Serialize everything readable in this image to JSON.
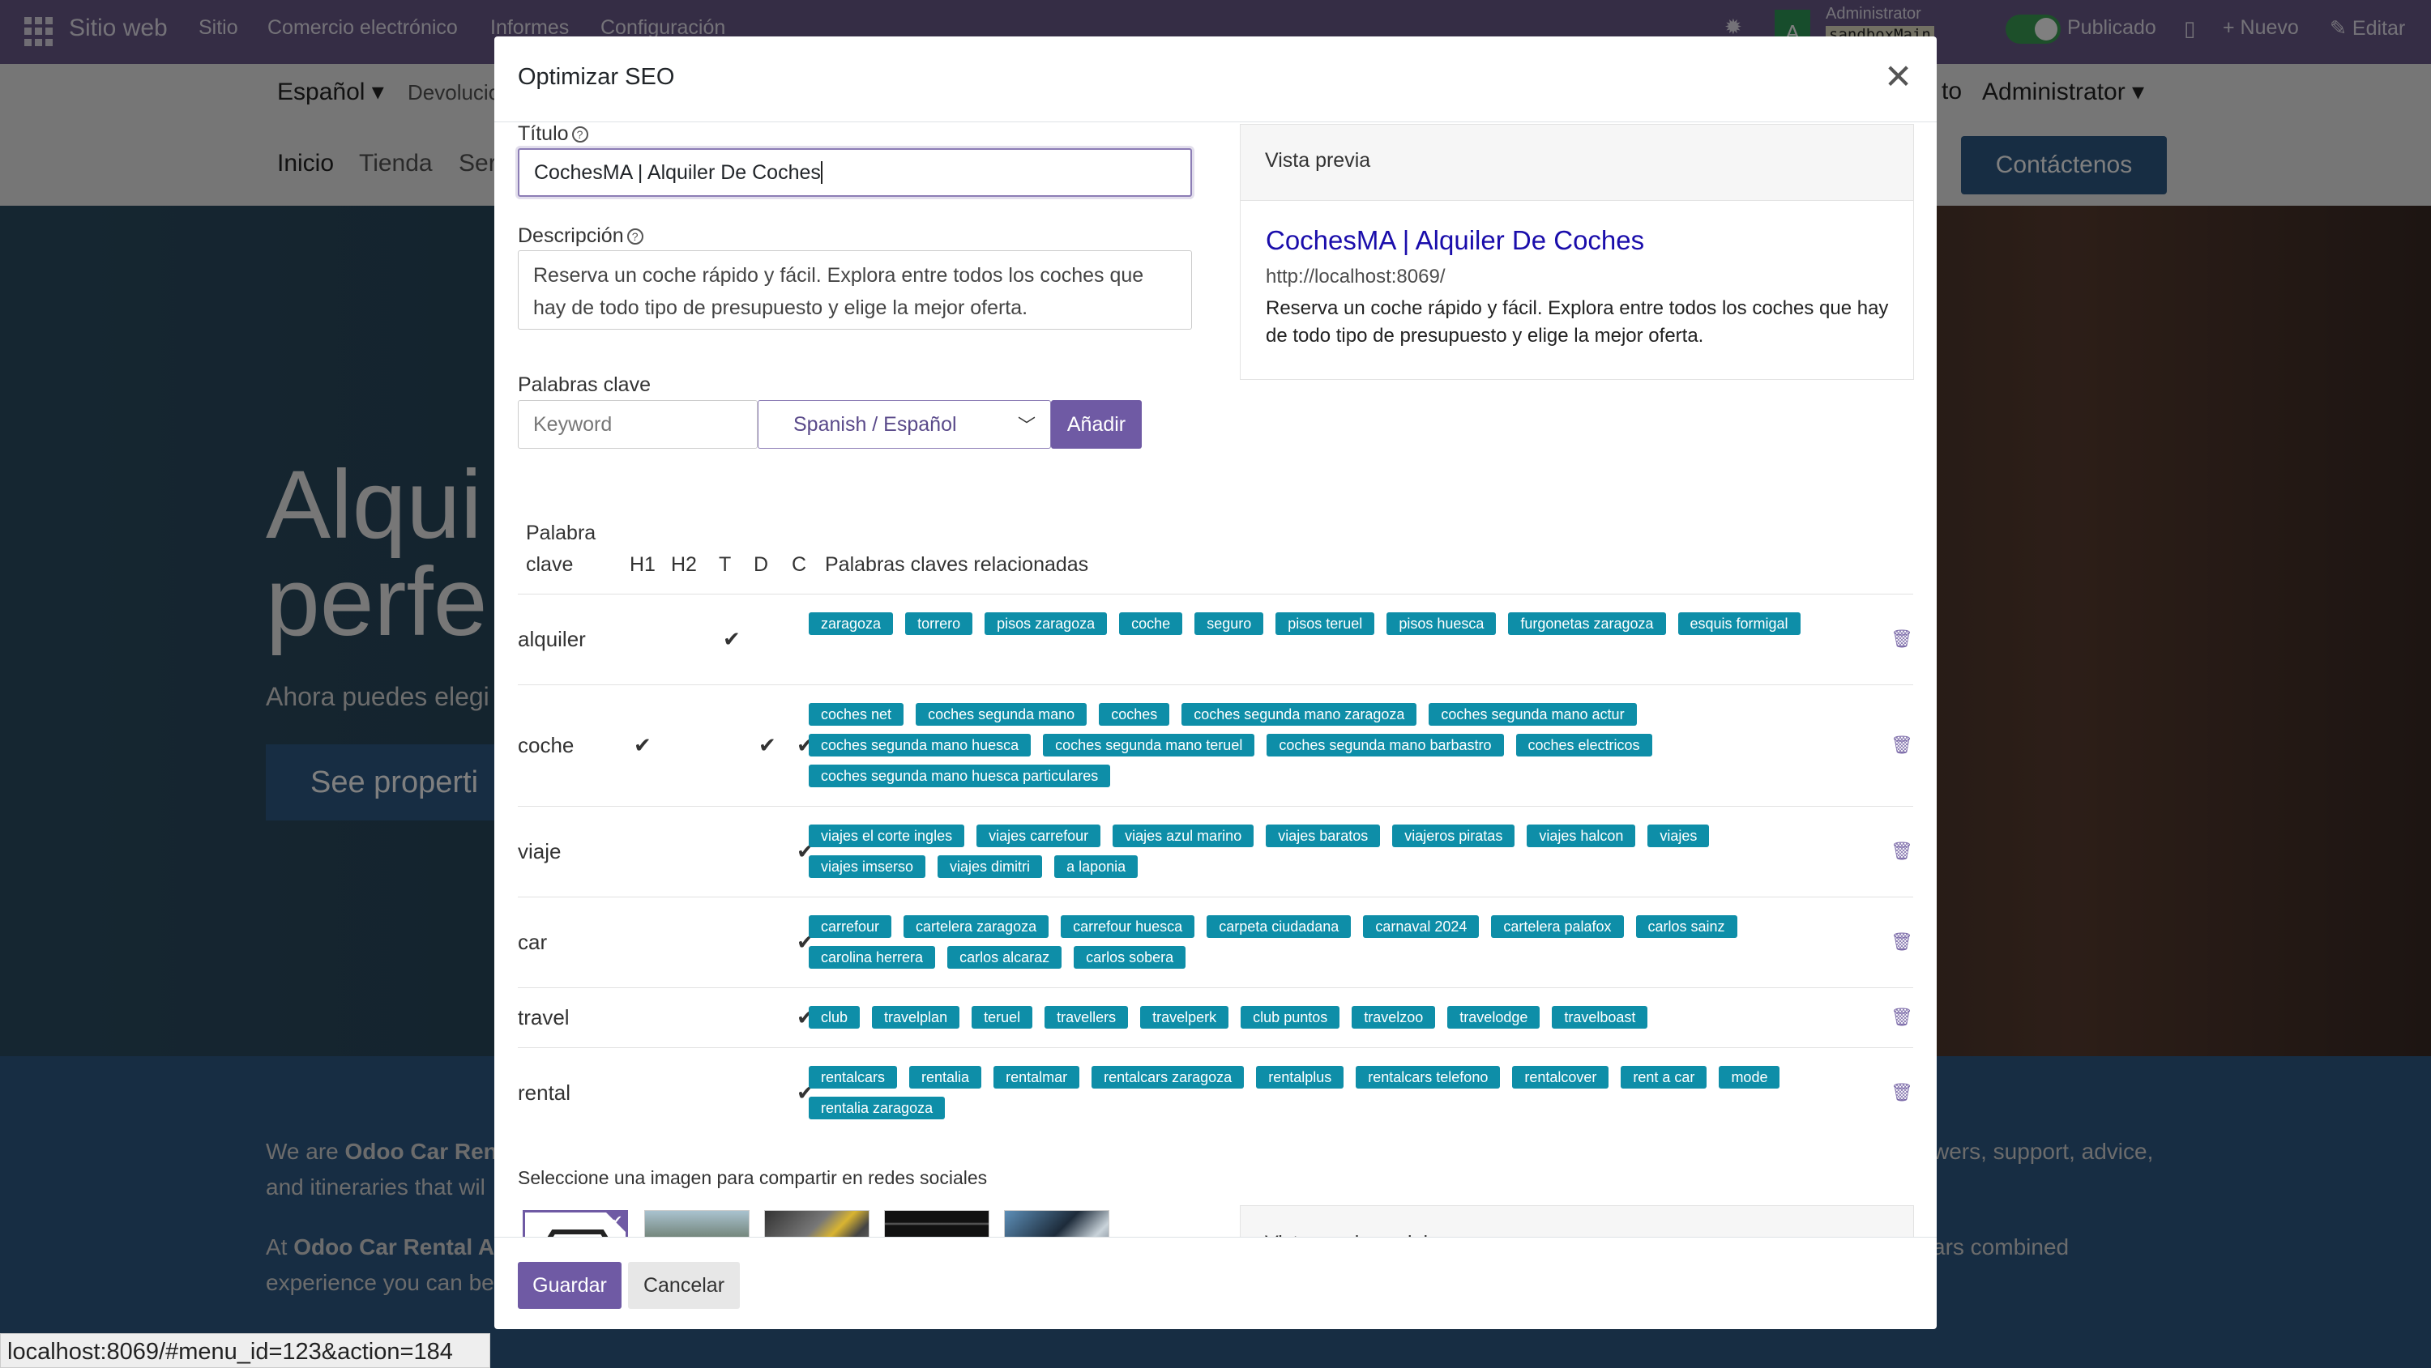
{
  "topbar": {
    "site": "Sitio web",
    "menus": [
      "Sitio",
      "Comercio electrónico",
      "Informes",
      "Configuración"
    ],
    "avatar": "A",
    "user": "Administrator",
    "db": "sandboxMain",
    "published": "Publicado",
    "new": "Nuevo",
    "edit": "Editar"
  },
  "subnav": {
    "lang": "Español",
    "returns": "Devolucio",
    "partial_right": "to",
    "admin": "Administrator",
    "nav": [
      "Inicio",
      "Tienda",
      "Ser"
    ],
    "contact": "Contáctenos"
  },
  "hero": {
    "line1": "Alqui",
    "line2": "perfe",
    "sub": "Ahora puedes elegi",
    "cta": "See properti"
  },
  "footer": {
    "l1a": "We are ",
    "l1b": "Odoo Car Ren",
    "l2": "and itineraries that wil",
    "l3a": "At ",
    "l3b": "Odoo Car Rental A",
    "l4": "experience you can be",
    "r1": "wers, support, advice,",
    "r2": "ars combined"
  },
  "status_url": "localhost:8069/#menu_id=123&action=184",
  "modal": {
    "title": "Optimizar SEO",
    "title_label": "Título",
    "title_value": "CochesMA | Alquiler De Coches",
    "desc_label": "Descripción",
    "desc_value": "Reserva un coche rápido y fácil. Explora entre todos los coches que hay de todo tipo de presupuesto y elige la mejor oferta.",
    "keywords_label": "Palabras clave",
    "keyword_placeholder": "Keyword",
    "language": "Spanish / Español",
    "add": "Añadir",
    "preview_label": "Vista previa",
    "preview_title": "CochesMA | Alquiler De Coches",
    "preview_url": "http://localhost:8069/",
    "preview_desc": "Reserva un coche rápido y fácil. Explora entre todos los coches que hay de todo tipo de presupuesto y elige la mejor oferta.",
    "headers": {
      "keyword1": "Palabra",
      "keyword2": "clave",
      "h1": "H1",
      "h2": "H2",
      "t": "T",
      "d": "D",
      "c": "C",
      "related": "Palabras claves relacionadas"
    },
    "rows": [
      {
        "kw": "alquiler",
        "h1": false,
        "h2": false,
        "t": true,
        "d": false,
        "c": false,
        "tags": [
          "zaragoza",
          "torrero",
          "pisos zaragoza",
          "coche",
          "seguro",
          "pisos teruel",
          "pisos huesca",
          "furgonetas zaragoza",
          "esquis formigal"
        ]
      },
      {
        "kw": "coche",
        "h1": true,
        "h2": false,
        "t": false,
        "d": true,
        "c": true,
        "tags": [
          "coches net",
          "coches segunda mano",
          "coches",
          "coches segunda mano zaragoza",
          "coches segunda mano actur",
          "coches segunda mano huesca",
          "coches segunda mano teruel",
          "coches segunda mano barbastro",
          "coches electricos",
          "coches segunda mano huesca particulares"
        ]
      },
      {
        "kw": "viaje",
        "h1": false,
        "h2": false,
        "t": false,
        "d": false,
        "c": true,
        "tags": [
          "viajes el corte ingles",
          "viajes carrefour",
          "viajes azul marino",
          "viajes baratos",
          "viajeros piratas",
          "viajes halcon",
          "viajes",
          "viajes imserso",
          "viajes dimitri",
          "a laponia"
        ]
      },
      {
        "kw": "car",
        "h1": false,
        "h2": false,
        "t": false,
        "d": false,
        "c": true,
        "tags": [
          "carrefour",
          "cartelera zaragoza",
          "carrefour huesca",
          "carpeta ciudadana",
          "carnaval 2024",
          "cartelera palafox",
          "carlos sainz",
          "carolina herrera",
          "carlos alcaraz",
          "carlos sobera"
        ]
      },
      {
        "kw": "travel",
        "h1": false,
        "h2": false,
        "t": false,
        "d": false,
        "c": true,
        "tags": [
          "club ",
          "travelplan",
          "teruel",
          "travellers",
          "travelperk",
          "club puntos",
          "travelzoo",
          "travelodge",
          "travelboast"
        ]
      },
      {
        "kw": "rental",
        "h1": false,
        "h2": false,
        "t": false,
        "d": false,
        "c": true,
        "tags": [
          "rentalcars",
          "rentalia",
          "rentalmar",
          "rentalcars zaragoza",
          "rentalplus",
          "rentalcars telefono",
          "rentalcover",
          "rent a car",
          "mode",
          "rentalia zaragoza"
        ]
      }
    ],
    "social_label": "Seleccione una imagen para compartir en redes sociales",
    "social_preview": "Vista previa social",
    "save": "Guardar",
    "cancel": "Cancelar"
  },
  "colors": {
    "primary": "#6f5aa4",
    "tag": "#0e8ea8",
    "link": "#1a0dab"
  }
}
